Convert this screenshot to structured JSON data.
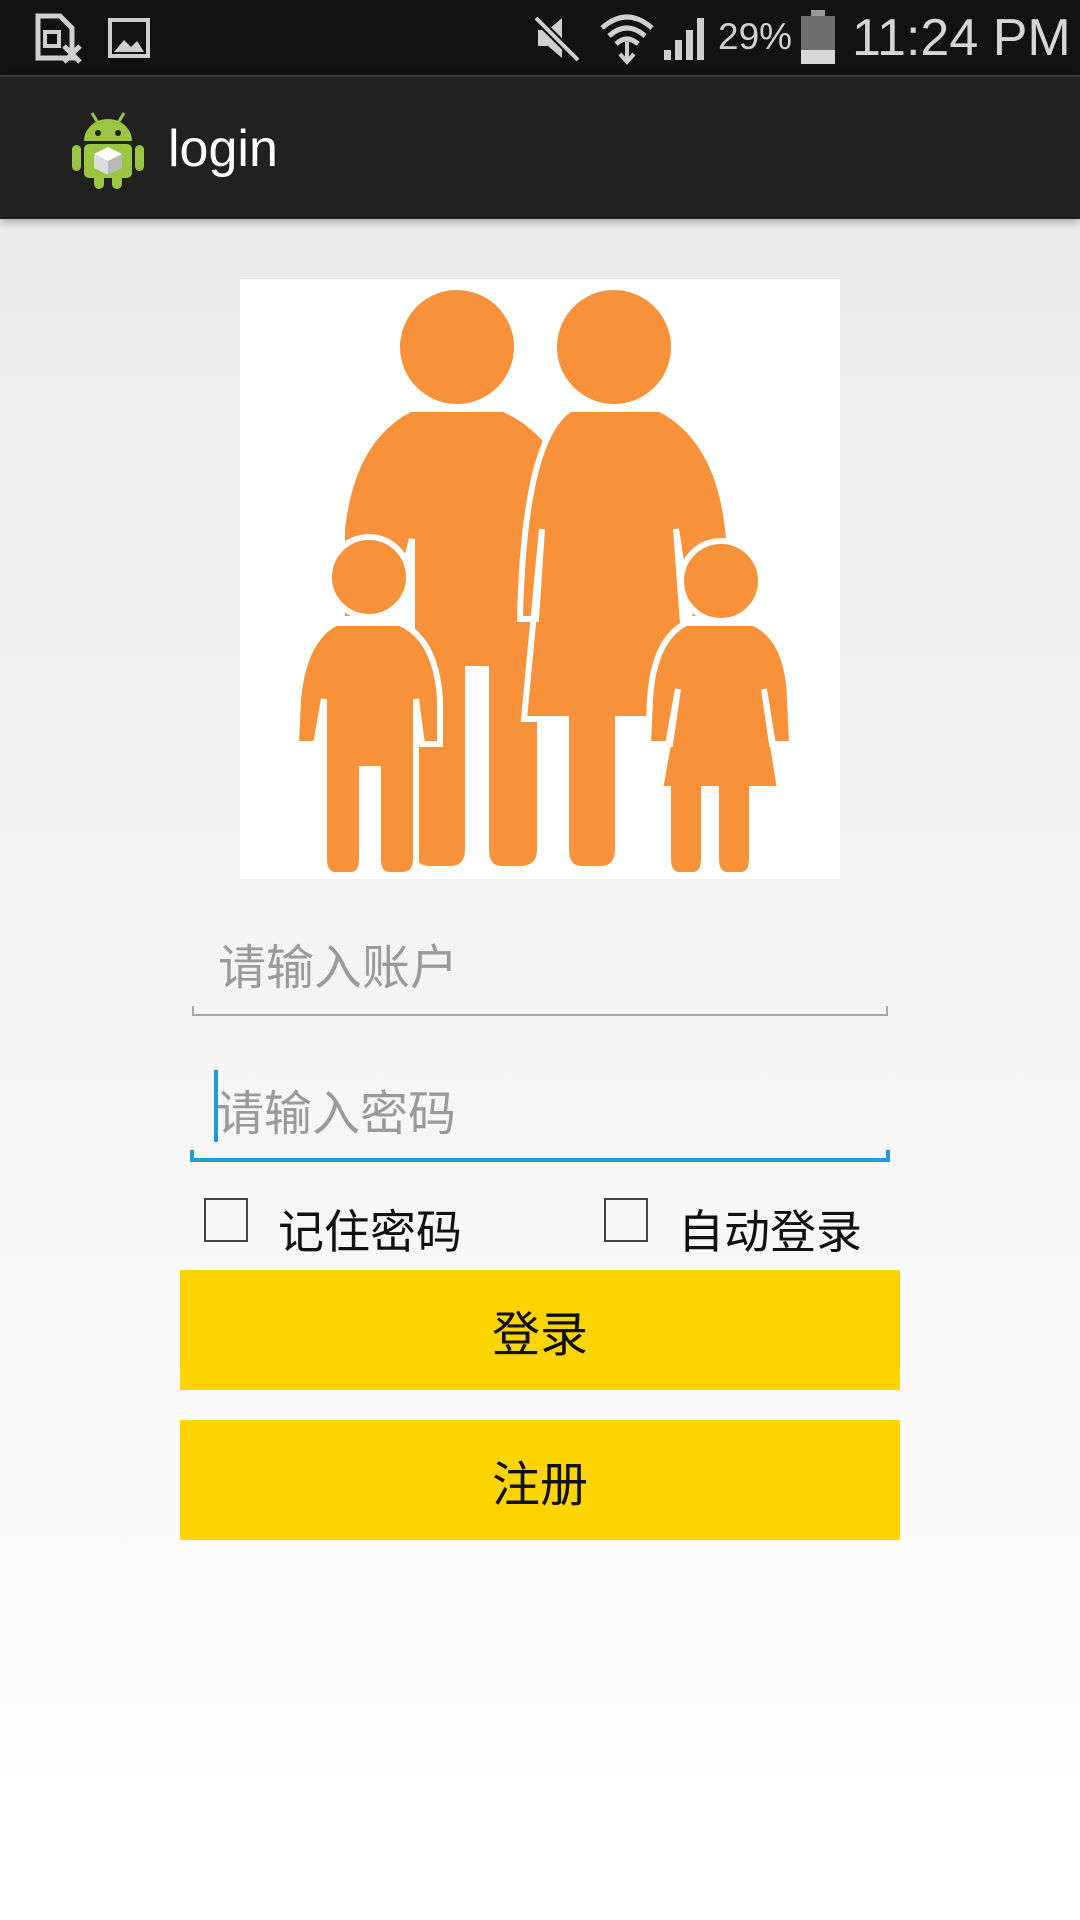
{
  "status_bar": {
    "left_icons": [
      "sim-card-off-icon",
      "image-icon"
    ],
    "right_icons": [
      "mute-icon",
      "wifi-icon",
      "signal-icon",
      "battery-icon"
    ],
    "battery_percent": "29%",
    "time": "11:24 PM"
  },
  "action_bar": {
    "app_icon": "android-app-icon",
    "title": "login"
  },
  "form": {
    "account_placeholder": "请输入账户",
    "password_placeholder": "请输入密码",
    "remember_label": "记住密码",
    "auto_login_label": "自动登录",
    "login_label": "登录",
    "register_label": "注册"
  },
  "colors": {
    "button": "#fcd500",
    "focus": "#1e9ad6",
    "illustration": "#f7913a"
  }
}
